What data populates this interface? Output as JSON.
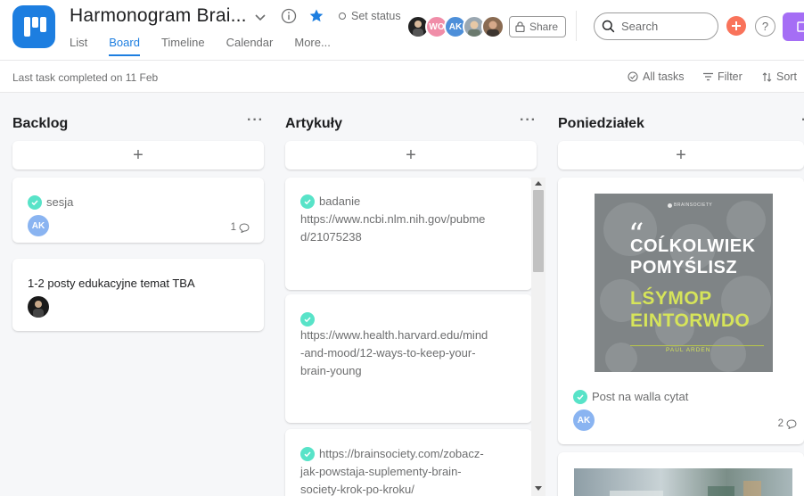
{
  "project": {
    "title": "Harmonogram Brai...",
    "set_status": "Set status",
    "share_label": "Share"
  },
  "tabs": [
    {
      "label": "List"
    },
    {
      "label": "Board"
    },
    {
      "label": "Timeline"
    },
    {
      "label": "Calendar"
    },
    {
      "label": "More..."
    }
  ],
  "members": [
    {
      "initials": ""
    },
    {
      "initials": "WO"
    },
    {
      "initials": "AK"
    },
    {
      "initials": ""
    },
    {
      "initials": ""
    }
  ],
  "search": {
    "placeholder": "Search"
  },
  "help_label": "?",
  "toolbar": {
    "last_task": "Last task completed on 11 Feb",
    "all_tasks": "All tasks",
    "filter": "Filter",
    "sort": "Sort"
  },
  "add_glyph": "+",
  "more_glyph": "···",
  "columns": [
    {
      "title": "Backlog",
      "cards": [
        {
          "title": "sesja",
          "assignee": "AK",
          "comments": "1"
        },
        {
          "title": "1-2 posty edukacyjne temat TBA"
        }
      ]
    },
    {
      "title": "Artykuły",
      "cards": [
        {
          "lines": [
            "badanie",
            "https://www.ncbi.nlm.nih.gov/pubme",
            "d/21075238"
          ]
        },
        {
          "lines": [
            "https://www.health.harvard.edu/mind",
            "-and-mood/12-ways-to-keep-your-",
            "brain-young"
          ]
        },
        {
          "lines": [
            "https://brainsociety.com/zobacz-",
            "jak-powstaja-suplementy-brain-",
            "society-krok-po-kroku/"
          ]
        }
      ]
    },
    {
      "title": "Poniedziałek",
      "cards": [
        {
          "title": "Post na walla cytat",
          "assignee": "AK",
          "comments": "2",
          "cover": {
            "brand": "BRAINSOCIETY",
            "quote_mark": "“",
            "line1": "COĹKOLWIEK",
            "line2": "POMYŚLISZ",
            "line3": "LŚYMOP",
            "line4": "EINTORWDO",
            "author": "PAUL ARDEN"
          }
        }
      ]
    }
  ],
  "colors": {
    "accent": "#1d7ee0",
    "check": "#58e3c8",
    "avatar_ak": "#8ab4f1",
    "avatar_wo": "#f08da8",
    "plus": "#f9735b",
    "upgrade": "#a56ef5",
    "quote_highlight": "#d6e45a"
  }
}
